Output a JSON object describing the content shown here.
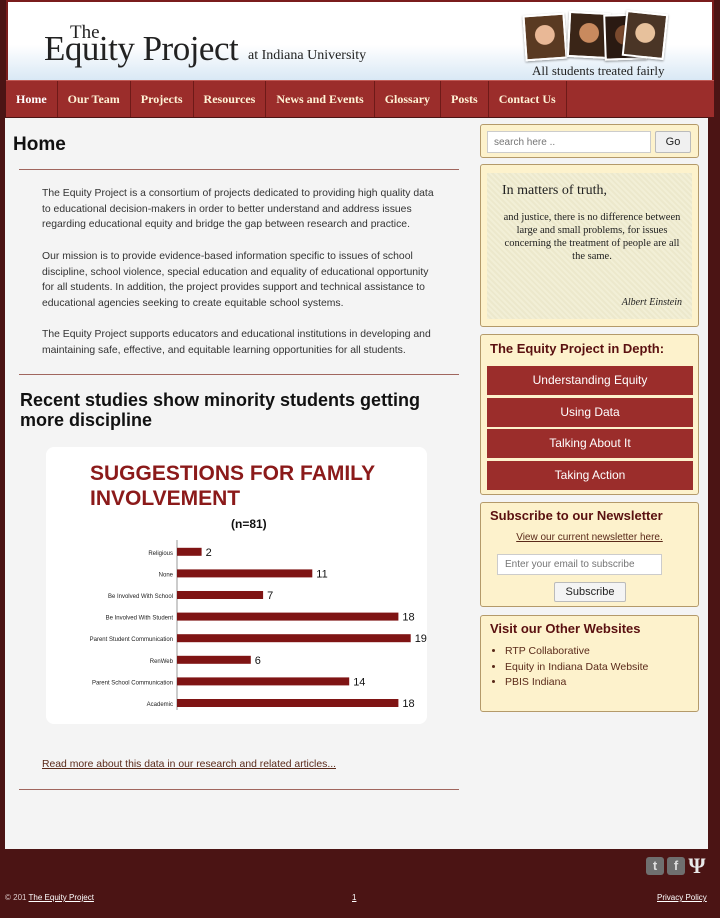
{
  "header": {
    "logo_the": "The",
    "logo_main": "Equity Project",
    "logo_sub": "at Indiana University",
    "tagline": "All students treated fairly"
  },
  "nav": {
    "items": [
      "Home",
      "Our Team",
      "Projects",
      "Resources",
      "News and Events",
      "Glossary",
      "Posts",
      "Contact Us"
    ]
  },
  "main": {
    "title": "Home",
    "paragraphs": [
      "The Equity Project is a consortium of projects dedicated to providing high quality data to educational decision-makers in order to better understand and address issues regarding educational equity and bridge the gap between research and practice.",
      "Our mission is to provide evidence-based information specific to issues of school discipline, school violence, special education and equality of educational opportunity for all students. In addition, the project provides support and technical assistance to educational agencies seeking to create equitable school systems.",
      "The Equity Project supports educators and educational institutions in developing and maintaining safe, effective, and equitable learning opportunities for all students."
    ],
    "article_title": "Recent studies show minority students getting more discipline",
    "read_more": "Read more about this data in our research and related articles..."
  },
  "chart_data": {
    "type": "bar",
    "title": "SUGGESTIONS FOR FAMILY INVOLVEMENT",
    "subtitle": "(n=81)",
    "categories": [
      "Religious",
      "None",
      "Be Involved With School",
      "Be Involved With Student",
      "Parent Student Communication",
      "RenWeb",
      "Parent School Communication",
      "Academic"
    ],
    "values": [
      2,
      11,
      7,
      18,
      19,
      6,
      14,
      18
    ],
    "orientation": "horizontal",
    "xlim": [
      0,
      20
    ],
    "bar_color": "#7f1414",
    "title_color": "#8b1a1a"
  },
  "sidebar": {
    "search_placeholder": "search here ..",
    "go_label": "Go",
    "quote_lead": "In matters of truth,",
    "quote_body": "and justice, there is no difference between large and small problems, for issues concerning the treatment of people are all the same.",
    "quote_author": "Albert Einstein",
    "depth_title": "The Equity Project in Depth:",
    "depth_items": [
      "Understanding Equity",
      "Using Data",
      "Talking About It",
      "Taking Action"
    ],
    "newsletter_title": "Subscribe to our Newsletter",
    "newsletter_link": "View our current newsletter here.",
    "email_placeholder": "Enter your email to subscribe",
    "subscribe_label": "Subscribe",
    "other_title": "Visit our Other Websites",
    "other_sites": [
      "RTP Collaborative",
      "Equity in Indiana Data Website",
      "PBIS Indiana"
    ]
  },
  "footer": {
    "copyright_prefix": "© 201",
    "copyright_link": "The Equity Project",
    "middle_link": "1",
    "privacy": "Privacy Policy",
    "twitter_glyph": "t",
    "facebook_glyph": "f",
    "iu_glyph": "Ψ"
  },
  "colors": {
    "brand_dark": "#4b1414",
    "nav": "#9b2d2b",
    "sidebar_box": "#fdf2cc"
  }
}
